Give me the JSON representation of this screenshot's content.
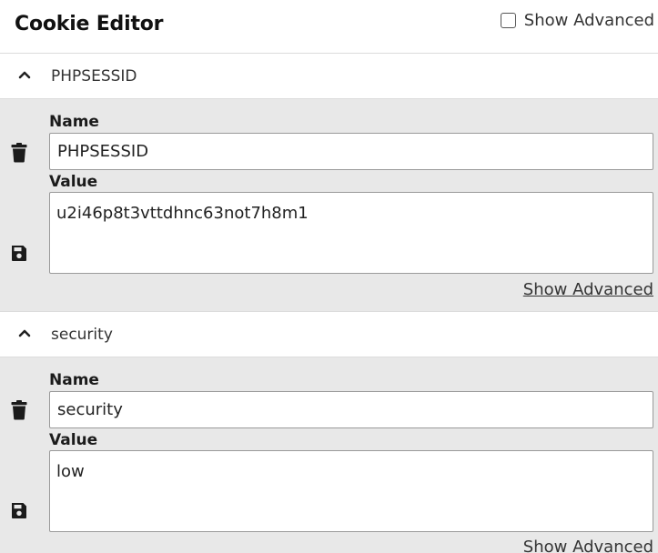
{
  "header": {
    "title": "Cookie Editor",
    "show_advanced_label": "Show Advanced",
    "show_advanced_checked": false
  },
  "cookies": [
    {
      "name": "PHPSESSID",
      "name_label": "Name",
      "name_value": "PHPSESSID",
      "value_label": "Value",
      "value": "u2i46p8t3vttdhnc63not7h8m1",
      "show_advanced_link": "Show Advanced",
      "expanded": true
    },
    {
      "name": "security",
      "name_label": "Name",
      "name_value": "security",
      "value_label": "Value",
      "value": "low",
      "show_advanced_link": "Show Advanced",
      "expanded": true
    }
  ],
  "icons": {
    "collapse": "chevron-up-icon",
    "delete": "trash-icon",
    "save": "save-icon",
    "checkbox": "checkbox-icon"
  },
  "colors": {
    "panel_background": "#e8e8e8",
    "header_background": "#ffffff",
    "border": "#dcdcdc",
    "text": "#1b1b1b"
  }
}
